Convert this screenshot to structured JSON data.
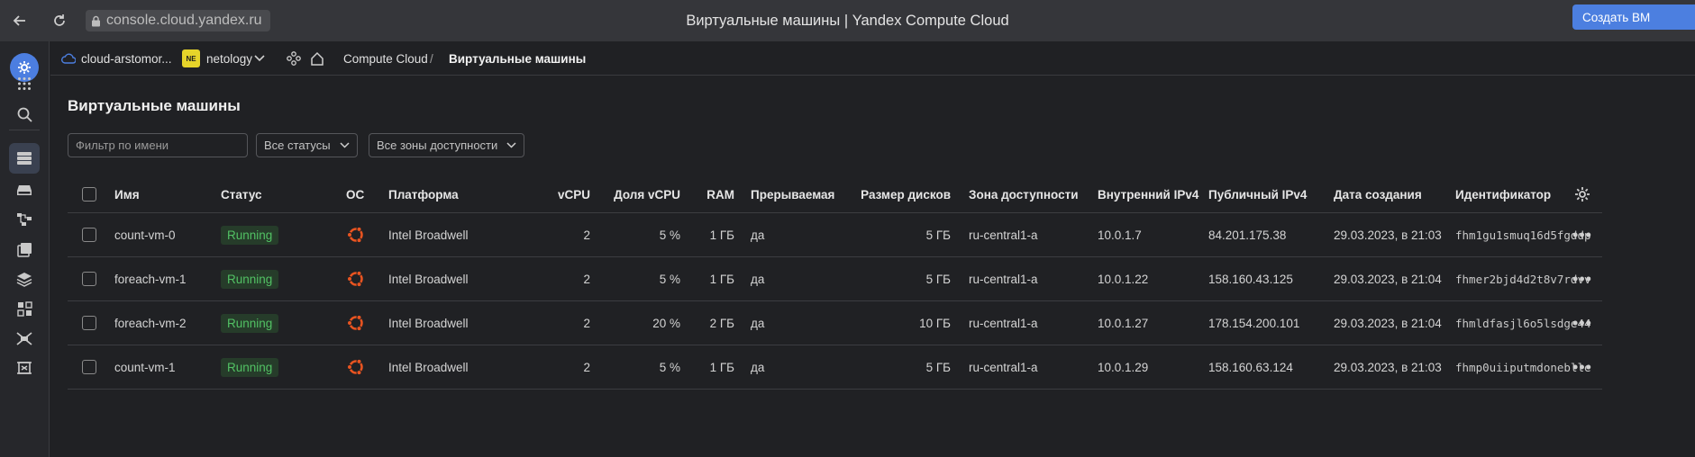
{
  "browser": {
    "url": "console.cloud.yandex.ru",
    "title": "Виртуальные машины | Yandex Compute Cloud"
  },
  "topbar": {
    "cloud": "cloud-arstomor...",
    "folder_badge": "NE",
    "folder": "netology",
    "breadcrumb_service": "Compute Cloud",
    "breadcrumb_sep": "/",
    "breadcrumb_current": "Виртуальные машины",
    "create_button": "Создать ВМ"
  },
  "main": {
    "title": "Виртуальные машины",
    "filter_name_placeholder": "Фильтр по имени",
    "filter_status": "Все статусы",
    "filter_zone": "Все зоны доступности"
  },
  "table": {
    "columns": {
      "name": "Имя",
      "status": "Статус",
      "os": "ОС",
      "platform": "Платформа",
      "vcpu": "vCPU",
      "vcpu_share": "Доля vCPU",
      "ram": "RAM",
      "preemptible": "Прерываемая",
      "disk_size": "Размер дисков",
      "zone": "Зона доступности",
      "ip_internal": "Внутренний IPv4",
      "ip_public": "Публичный IPv4",
      "created": "Дата создания",
      "id": "Идентификатор"
    },
    "rows": [
      {
        "name": "count-vm-0",
        "status": "Running",
        "os_icon": "ubuntu-icon",
        "platform": "Intel Broadwell",
        "vcpu": "2",
        "vcpu_share": "5 %",
        "ram": "1 ГБ",
        "preemptible": "да",
        "disk_size": "5 ГБ",
        "zone": "ru-central1-a",
        "ip_internal": "10.0.1.7",
        "ip_public": "84.201.175.38",
        "created": "29.03.2023, в 21:03",
        "id": "fhm1gu1smuq16d5fgddp"
      },
      {
        "name": "foreach-vm-1",
        "status": "Running",
        "os_icon": "ubuntu-icon",
        "platform": "Intel Broadwell",
        "vcpu": "2",
        "vcpu_share": "5 %",
        "ram": "1 ГБ",
        "preemptible": "да",
        "disk_size": "5 ГБ",
        "zone": "ru-central1-a",
        "ip_internal": "10.0.1.22",
        "ip_public": "158.160.43.125",
        "created": "29.03.2023, в 21:04",
        "id": "fhmer2bjd4d2t8v7rdvv"
      },
      {
        "name": "foreach-vm-2",
        "status": "Running",
        "os_icon": "ubuntu-icon",
        "platform": "Intel Broadwell",
        "vcpu": "2",
        "vcpu_share": "20 %",
        "ram": "2 ГБ",
        "preemptible": "да",
        "disk_size": "10 ГБ",
        "zone": "ru-central1-a",
        "ip_internal": "10.0.1.27",
        "ip_public": "178.154.200.101",
        "created": "29.03.2023, в 21:04",
        "id": "fhmldfasjl6o5lsdge44"
      },
      {
        "name": "count-vm-1",
        "status": "Running",
        "os_icon": "ubuntu-icon",
        "platform": "Intel Broadwell",
        "vcpu": "2",
        "vcpu_share": "5 %",
        "ram": "1 ГБ",
        "preemptible": "да",
        "disk_size": "5 ГБ",
        "zone": "ru-central1-a",
        "ip_internal": "10.0.1.29",
        "ip_public": "158.160.63.124",
        "created": "29.03.2023, в 21:03",
        "id": "fhmp0uiiputmdoneblle"
      }
    ]
  },
  "colors": {
    "accent": "#4c7fe0",
    "running": "#52c264",
    "ubuntu": "#e95420",
    "folder_badge": "#e6d42a"
  }
}
